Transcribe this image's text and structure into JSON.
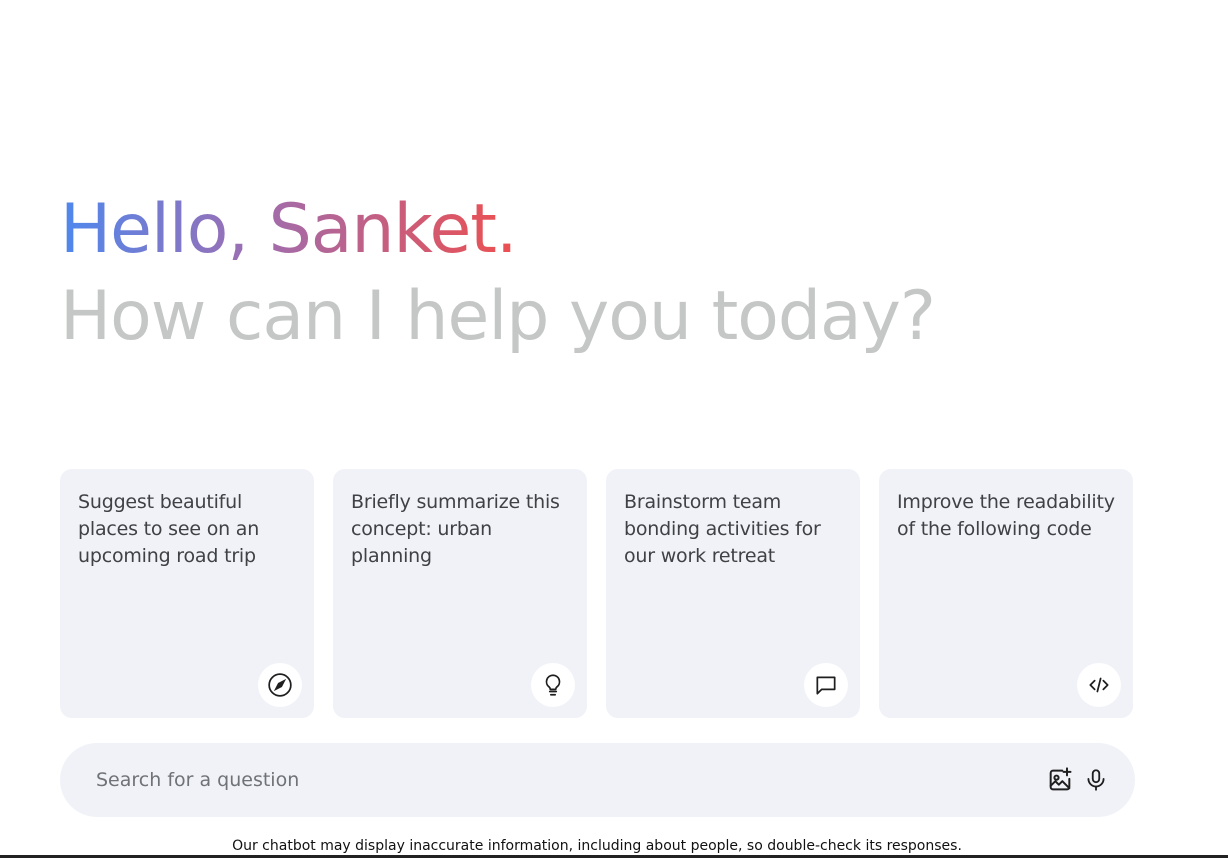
{
  "greeting": {
    "hello": "Hello, Sanket.",
    "subtitle": "How can I help you today?"
  },
  "cards": [
    {
      "text": "Suggest beautiful places to see on an upcoming road trip",
      "icon": "compass-icon"
    },
    {
      "text": "Briefly summarize this concept: urban planning",
      "icon": "lightbulb-icon"
    },
    {
      "text": "Brainstorm team bonding activities for our work retreat",
      "icon": "chat-bubble-icon"
    },
    {
      "text": "Improve the readability of the following code",
      "icon": "code-icon"
    }
  ],
  "search": {
    "placeholder": "Search for a question",
    "value": ""
  },
  "disclaimer": "Our chatbot may display inaccurate information, including about people, so double-check its responses.",
  "colors": {
    "gradient_start": "#4e88ee",
    "gradient_mid": "#9a6fb4",
    "gradient_end": "#ee4f4f",
    "subtitle": "#c4c7c5",
    "card_bg": "#f0f2f7"
  }
}
